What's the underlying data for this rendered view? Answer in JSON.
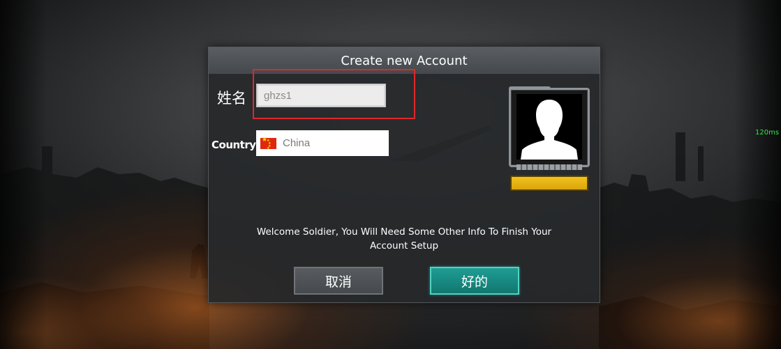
{
  "hud": {
    "latency": "120ms",
    "latency_color": "#2ee84a"
  },
  "dialog": {
    "title": "Create new Account",
    "name_label": "姓名",
    "name_value": "ghzs1",
    "country_label": "Country",
    "country_value": "China",
    "country_flag": "china-flag-icon",
    "avatar_icon": "default-avatar-silhouette-icon",
    "welcome_text": "Welcome Soldier, You Will Need Some Other Info To Finish Your Account Setup",
    "cancel_label": "取消",
    "ok_label": "好的"
  },
  "colors": {
    "ok_button": "#11776f",
    "rank_bar": "#f2c21b",
    "highlight": "#e0282a"
  }
}
